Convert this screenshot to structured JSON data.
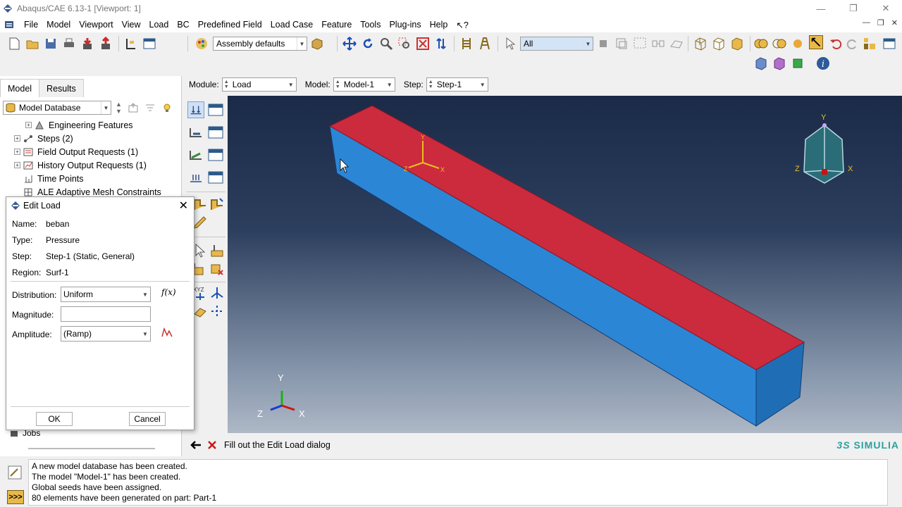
{
  "window": {
    "title": "Abaqus/CAE 6.13-1 [Viewport: 1]"
  },
  "menu": [
    "File",
    "Model",
    "Viewport",
    "View",
    "Load",
    "BC",
    "Predefined Field",
    "Load Case",
    "Feature",
    "Tools",
    "Plug-ins",
    "Help",
    "↖?"
  ],
  "toolbar": {
    "render_style": "Assembly defaults",
    "selection_filter": "All"
  },
  "module_bar": {
    "module_label": "Module:",
    "module_value": "Load",
    "model_label": "Model:",
    "model_value": "Model-1",
    "step_label": "Step:",
    "step_value": "Step-1"
  },
  "left_panel": {
    "tabs": [
      "Model",
      "Results"
    ],
    "database": "Model Database",
    "tree": [
      {
        "label": "Engineering Features",
        "expander": "+",
        "indent": 1
      },
      {
        "label": "Steps (2)",
        "expander": "+",
        "indent": 0
      },
      {
        "label": "Field Output Requests (1)",
        "expander": "+",
        "indent": 0
      },
      {
        "label": "History Output Requests (1)",
        "expander": "+",
        "indent": 0
      },
      {
        "label": "Time Points",
        "expander": "",
        "indent": 0
      },
      {
        "label": "ALE Adaptive Mesh Constraints",
        "expander": "",
        "indent": 0
      }
    ],
    "jobs_label": "Jobs"
  },
  "dialog": {
    "title": "Edit Load",
    "name_label": "Name:",
    "name_value": "beban",
    "type_label": "Type:",
    "type_value": "Pressure",
    "step_label": "Step:",
    "step_value": "Step-1 (Static, General)",
    "region_label": "Region:",
    "region_value": "Surf-1",
    "distribution_label": "Distribution:",
    "distribution_value": "Uniform",
    "magnitude_label": "Magnitude:",
    "magnitude_value": "",
    "amplitude_label": "Amplitude:",
    "amplitude_value": "(Ramp)",
    "fx_label": "f(x)",
    "ok_label": "OK",
    "cancel_label": "Cancel"
  },
  "prompt": {
    "text": "Fill out the Edit Load dialog"
  },
  "brand": "SIMULIA",
  "triad": {
    "x": "X",
    "y": "Y",
    "z": "Z"
  },
  "messages": [
    "A new model database has been created.",
    "The model \"Model-1\" has been created.",
    "Global seeds have been assigned.",
    "80 elements have been generated on part: Part-1"
  ],
  "colors": {
    "beam_top": "#cc2b3d",
    "beam_side": "#2c86d6",
    "beam_end": "#1f6eb5",
    "viewport_top": "#1a2a47",
    "viewport_bottom": "#aeb8c6"
  }
}
